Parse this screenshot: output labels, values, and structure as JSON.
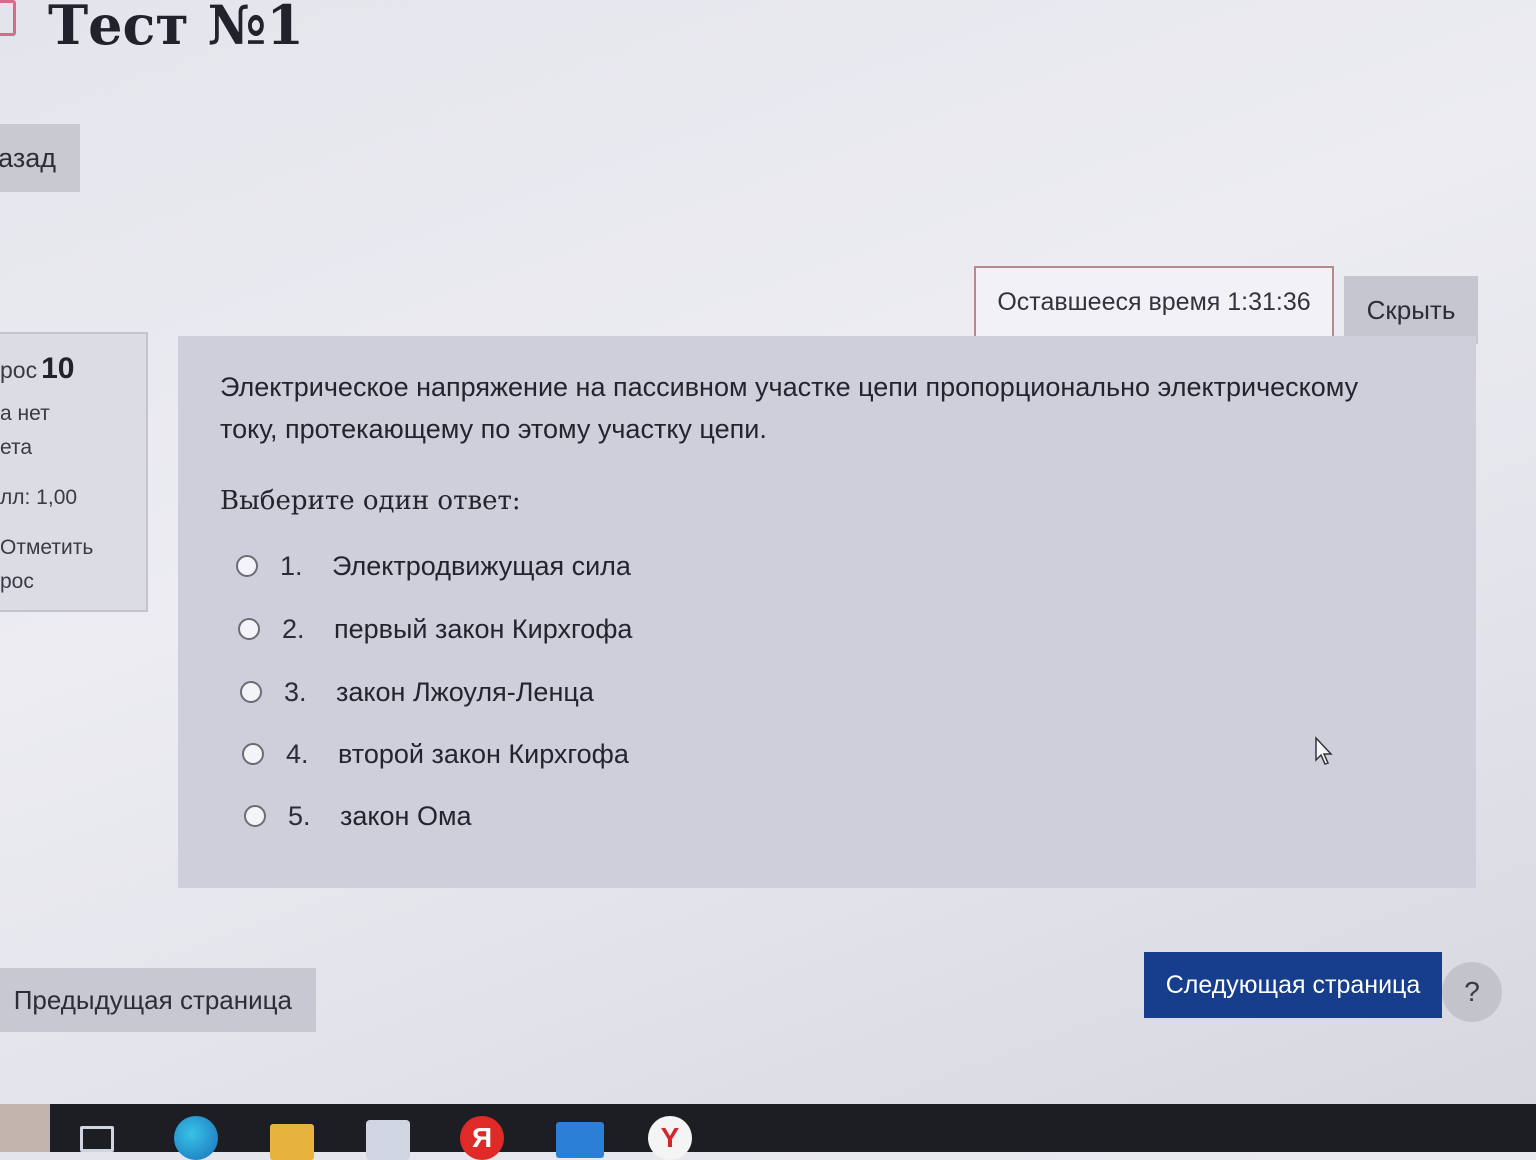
{
  "header": {
    "title": "Тест №1",
    "back_label": "азад"
  },
  "question_info": {
    "label": "рос",
    "number": "10",
    "status_line1": "а нет",
    "status_line2": "ета",
    "mark": "лл: 1,00",
    "flag_line1": "Отметить",
    "flag_line2": "рос"
  },
  "timer": {
    "text": "Оставшееся время 1:31:36",
    "hide_label": "Скрыть"
  },
  "question": {
    "text": "Электрическое напряжение на пассивном участке цепи пропорционально электрическому току, протекающему по этому участку цепи.",
    "prompt": "Выберите один ответ:",
    "answers": [
      {
        "num": "1.",
        "text": "Электродвижущая сила"
      },
      {
        "num": "2.",
        "text": "первый закон Кирхгофа"
      },
      {
        "num": "3.",
        "text": "закон Лжоуля-Ленца"
      },
      {
        "num": "4.",
        "text": "второй закон Кирхгофа"
      },
      {
        "num": "5.",
        "text": "закон Ома"
      }
    ]
  },
  "nav": {
    "prev_label": "Предыдущая страница",
    "next_label": "Следующая страница",
    "help_label": "?"
  },
  "taskbar": {
    "icons": [
      "task-view-icon",
      "edge-icon",
      "file-explorer-icon",
      "store-icon",
      "yandex-icon",
      "mail-icon",
      "yandex-browser-icon"
    ],
    "yandex_glyph": "Я",
    "ybrowser_glyph": "Y"
  },
  "colors": {
    "primary": "#173e8c",
    "card": "#cfcfdc",
    "timer_border": "#b58a8a"
  }
}
